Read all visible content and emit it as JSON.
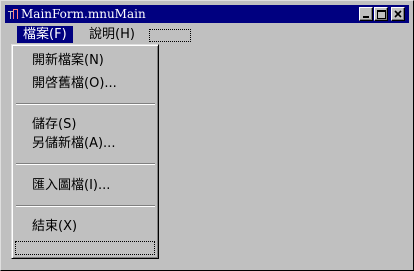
{
  "window": {
    "title": "MainForm.mnuMain"
  },
  "caption_buttons": {
    "minimize_icon": "minimize-icon",
    "maximize_icon": "maximize-icon",
    "close_icon": "close-icon"
  },
  "menubar": {
    "file": {
      "label": "檔案",
      "accel": "(F)"
    },
    "help": {
      "label": "說明",
      "accel": "(H)"
    }
  },
  "file_menu": {
    "new_file": {
      "label": "開新檔案",
      "accel": "(N)"
    },
    "open_old": {
      "label": "開啓舊檔",
      "accel": "(O)...",
      "_suffix": "..."
    },
    "save": {
      "label": "儲存",
      "accel": "(S)"
    },
    "save_as": {
      "label": "另儲新檔",
      "accel": "(A)..."
    },
    "import_image": {
      "label": "匯入圖檔",
      "accel": "(I)..."
    },
    "exit": {
      "label": "結束",
      "accel": "(X)"
    }
  },
  "colors": {
    "title_bg": "#000080",
    "highlight_bg": "#000080",
    "face": "#c0c0c0"
  }
}
